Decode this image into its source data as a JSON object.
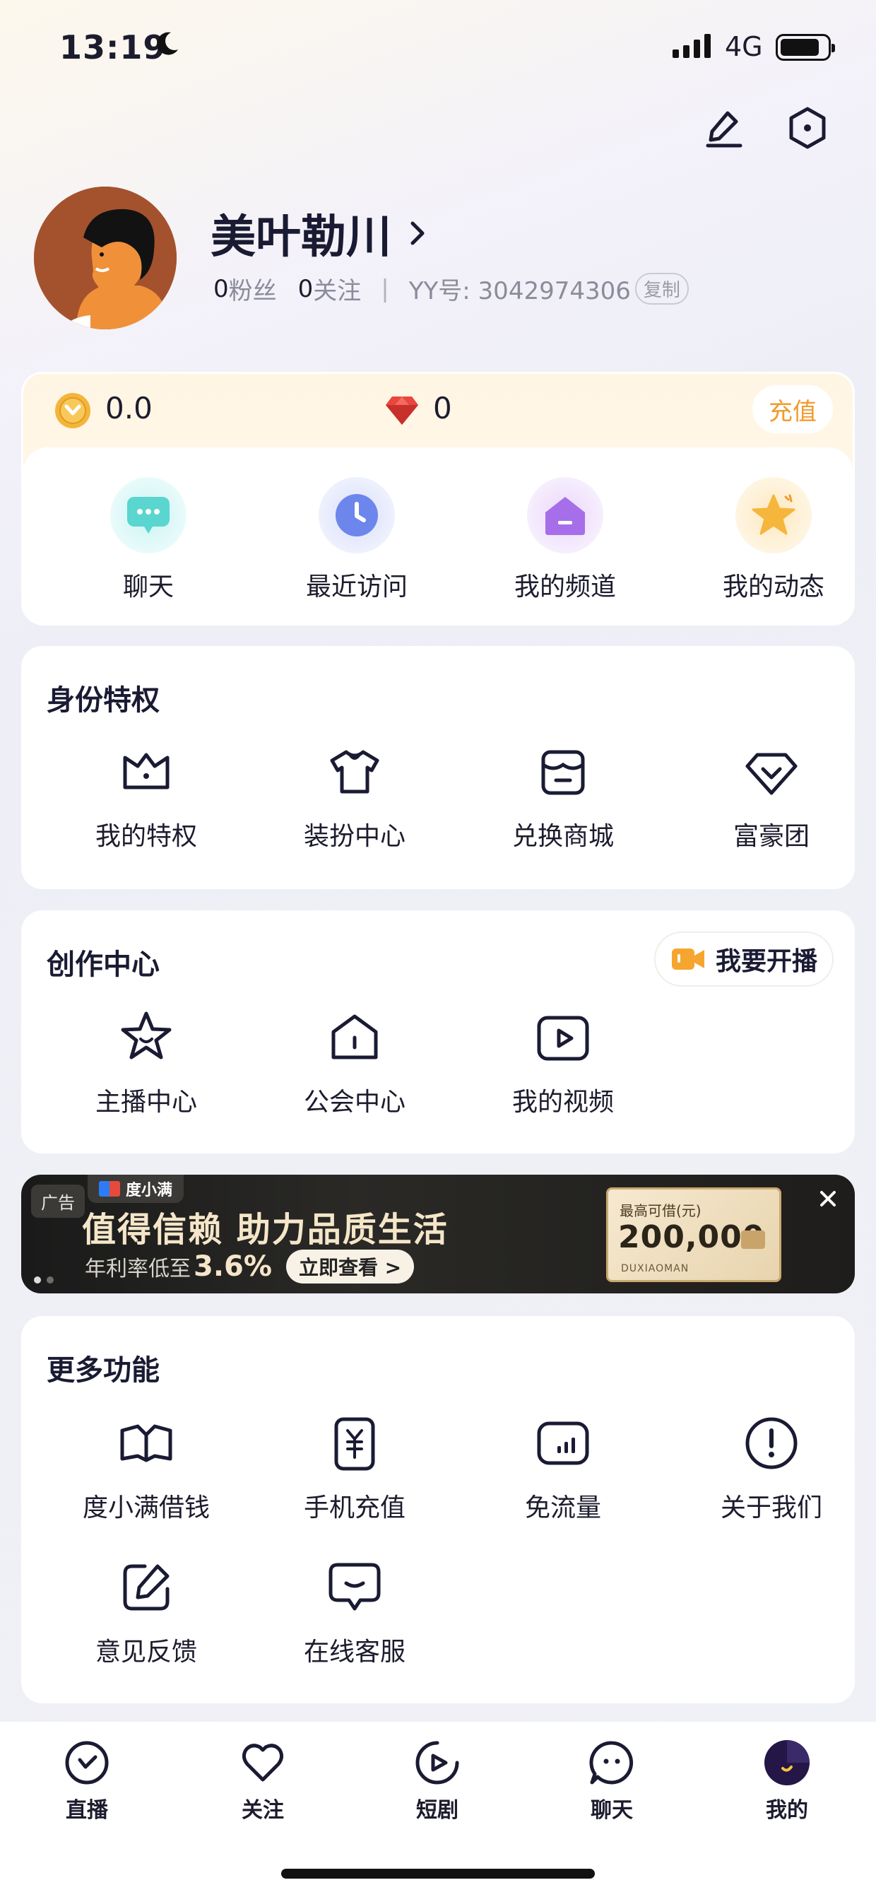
{
  "status_bar": {
    "time": "13:19",
    "network": "4G"
  },
  "profile": {
    "name": "美叶勒川",
    "fans_count": "0",
    "fans_label": "粉丝",
    "follow_count": "0",
    "follow_label": "关注",
    "separator": "|",
    "yy_id": "YY号: 3042974306",
    "copy_label": "复制"
  },
  "wallet": {
    "coins": "0.0",
    "gems": "0",
    "recharge_label": "充值"
  },
  "quick_actions": [
    {
      "label": "聊天",
      "icon": "chat-bubble-icon"
    },
    {
      "label": "最近访问",
      "icon": "clock-icon"
    },
    {
      "label": "我的频道",
      "icon": "home-channel-icon"
    },
    {
      "label": "我的动态",
      "icon": "star-icon"
    }
  ],
  "privileges": {
    "title": "身份特权",
    "items": [
      {
        "label": "我的特权",
        "icon": "crown-icon"
      },
      {
        "label": "装扮中心",
        "icon": "tshirt-icon"
      },
      {
        "label": "兑换商城",
        "icon": "store-icon"
      },
      {
        "label": "富豪团",
        "icon": "diamond-icon"
      }
    ]
  },
  "creator": {
    "title": "创作中心",
    "live_label": "我要开播",
    "items": [
      {
        "label": "主播中心",
        "icon": "star-face-icon"
      },
      {
        "label": "公会中心",
        "icon": "house-icon"
      },
      {
        "label": "我的视频",
        "icon": "video-play-icon"
      }
    ]
  },
  "ad": {
    "tag": "广告",
    "brand": "度小满",
    "headline": "值得信赖  助力品质生活",
    "sub_prefix": "年利率低至",
    "rate": "3.6%",
    "cta": "立即查看 >",
    "card_title": "最高可借(元)",
    "card_amount": "200,000",
    "card_brand": "DUXIAOMAN"
  },
  "more": {
    "title": "更多功能",
    "items": [
      {
        "label": "度小满借钱",
        "icon": "open-book-icon"
      },
      {
        "label": "手机充值",
        "icon": "phone-yuan-icon"
      },
      {
        "label": "免流量",
        "icon": "data-bars-icon"
      },
      {
        "label": "关于我们",
        "icon": "info-exclamation-icon"
      },
      {
        "label": "意见反馈",
        "icon": "edit-square-icon"
      },
      {
        "label": "在线客服",
        "icon": "chat-smile-icon"
      }
    ]
  },
  "tabbar": [
    {
      "label": "直播",
      "icon": "live-icon"
    },
    {
      "label": "关注",
      "icon": "heart-icon"
    },
    {
      "label": "短剧",
      "icon": "play-icon"
    },
    {
      "label": "聊天",
      "icon": "chat-face-icon"
    },
    {
      "label": "我的",
      "icon": "profile-avatar-icon",
      "active": true
    }
  ]
}
